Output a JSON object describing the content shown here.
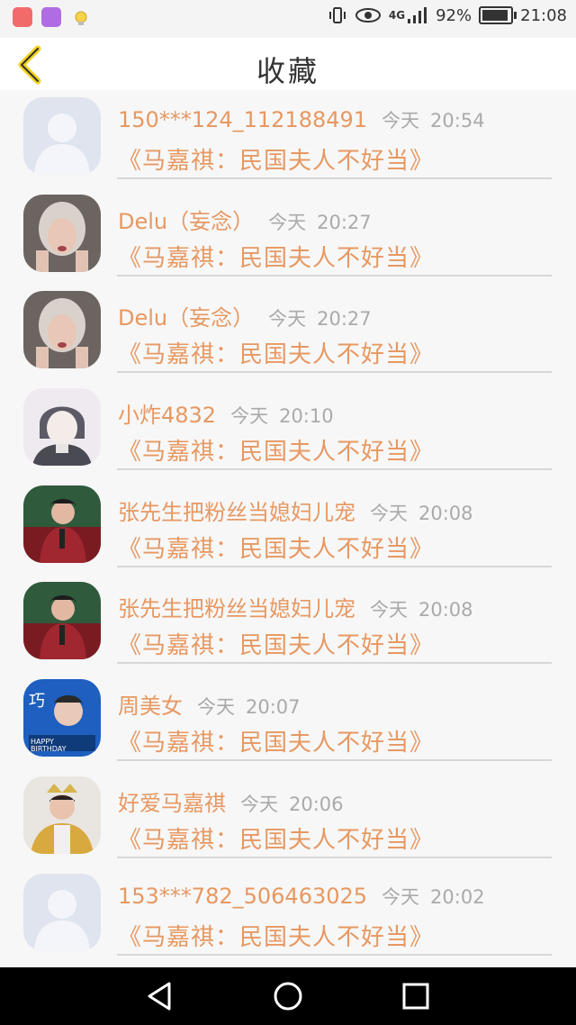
{
  "status_bar": {
    "network": "4G",
    "battery": "92%",
    "battery_level": 0.92,
    "time": "21:08"
  },
  "header": {
    "title": "收藏"
  },
  "items": [
    {
      "name": "150***124_112188491",
      "day": "今天",
      "time": "20:54",
      "book": "《马嘉祺：民国夫人不好当》",
      "avatar": "default-user"
    },
    {
      "name": "Delu（妄念）",
      "day": "今天",
      "time": "20:27",
      "book": "《马嘉祺：民国夫人不好当》",
      "avatar": "photo-girl"
    },
    {
      "name": "Delu（妄念）",
      "day": "今天",
      "time": "20:27",
      "book": "《马嘉祺：民国夫人不好当》",
      "avatar": "photo-girl"
    },
    {
      "name": "小炸4832",
      "day": "今天",
      "time": "20:10",
      "book": "《马嘉祺：民国夫人不好当》",
      "avatar": "anime-boy"
    },
    {
      "name": "张先生把粉丝当媳妇儿宠",
      "day": "今天",
      "time": "20:08",
      "book": "《马嘉祺：民国夫人不好当》",
      "avatar": "photo-singer"
    },
    {
      "name": "张先生把粉丝当媳妇儿宠",
      "day": "今天",
      "time": "20:08",
      "book": "《马嘉祺：民国夫人不好当》",
      "avatar": "photo-singer"
    },
    {
      "name": "周美女",
      "day": "今天",
      "time": "20:07",
      "book": "《马嘉祺：民国夫人不好当》",
      "avatar": "birthday-poster"
    },
    {
      "name": "好爱马嘉祺",
      "day": "今天",
      "time": "20:06",
      "book": "《马嘉祺：民国夫人不好当》",
      "avatar": "photo-crown"
    },
    {
      "name": "153***782_506463025",
      "day": "今天",
      "time": "20:02",
      "book": "《马嘉祺：民国夫人不好当》",
      "avatar": "default-user"
    }
  ],
  "colors": {
    "accent": "#e79862",
    "meta": "#aaaaaa",
    "background": "#f7f7f7"
  }
}
